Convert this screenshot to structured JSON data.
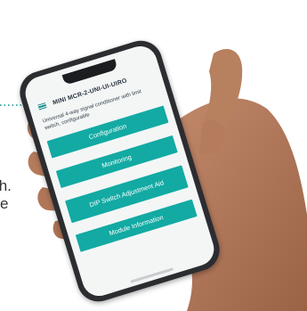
{
  "app": {
    "title": "MINI MCR-2-UNI-UI-UIRO",
    "subtitle": "Universal 4-way signal conditioner with limit switch, configurable"
  },
  "menu": {
    "items": [
      {
        "label": "Configuration"
      },
      {
        "label": "Monitoring"
      },
      {
        "label": "DIP Switch Adjustment Aid"
      },
      {
        "label": "Module Information"
      }
    ]
  },
  "background_text": {
    "line1": "th.",
    "line2": "e"
  },
  "colors": {
    "accent": "#12aaa3",
    "connector": "#0f8d8a"
  }
}
